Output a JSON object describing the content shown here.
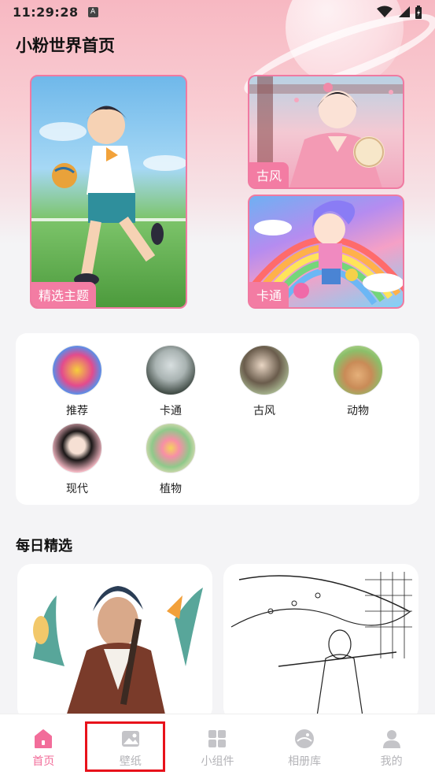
{
  "status": {
    "time": "11:29:28",
    "a_badge": "A"
  },
  "header": {
    "title": "小粉世界首页"
  },
  "featured": {
    "main_label": "精选主题",
    "top_right_label": "古风",
    "bottom_right_label": "卡通"
  },
  "categories": [
    {
      "label": "推荐"
    },
    {
      "label": "卡通"
    },
    {
      "label": "古风"
    },
    {
      "label": "动物"
    },
    {
      "label": "现代"
    },
    {
      "label": "植物"
    }
  ],
  "daily": {
    "title": "每日精选"
  },
  "tabs": [
    {
      "label": "首页",
      "icon": "home-icon",
      "active": true
    },
    {
      "label": "壁纸",
      "icon": "image-icon",
      "active": false
    },
    {
      "label": "小组件",
      "icon": "grid-icon",
      "active": false
    },
    {
      "label": "相册库",
      "icon": "album-icon",
      "active": false
    },
    {
      "label": "我的",
      "icon": "user-icon",
      "active": false
    }
  ],
  "colors": {
    "accent": "#f26d9a",
    "inactive": "#b4b4b8",
    "highlight": "#e8121b"
  }
}
